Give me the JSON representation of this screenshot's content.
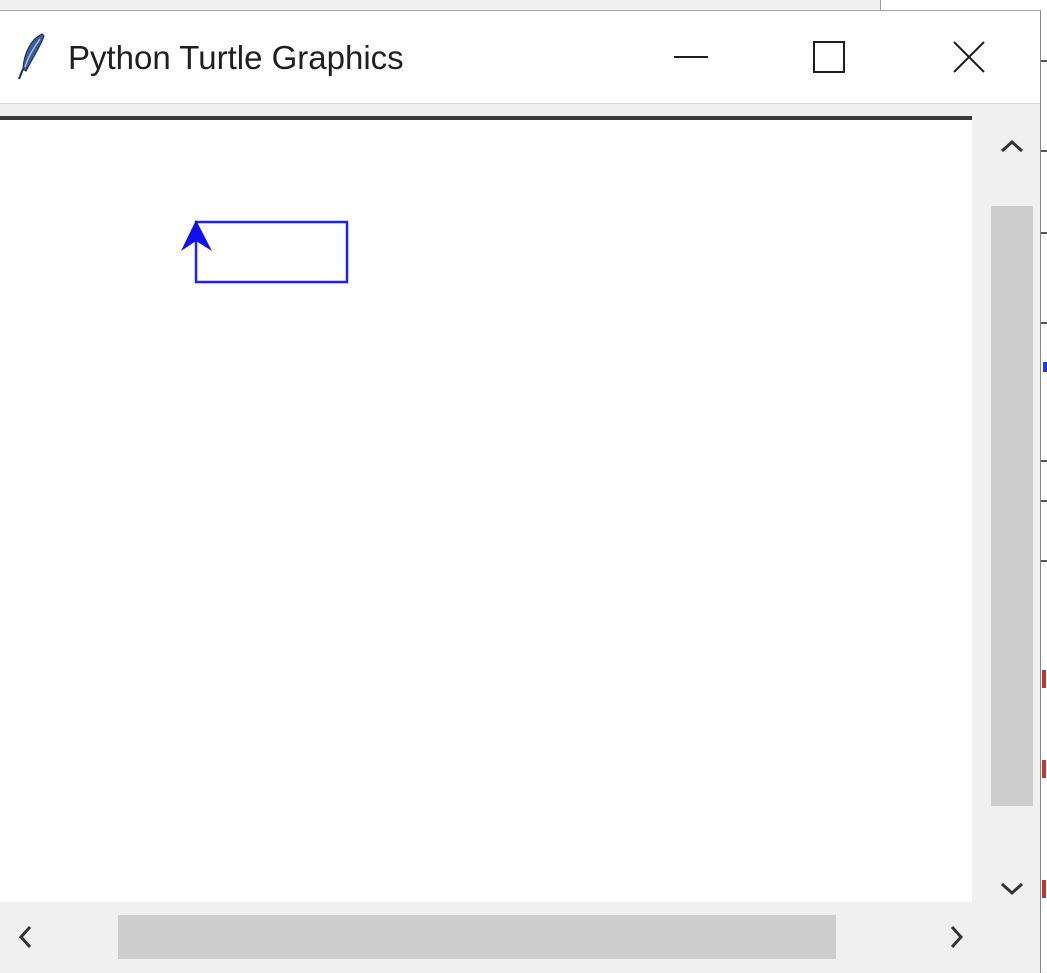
{
  "window": {
    "title": "Python Turtle Graphics",
    "icon": "feather-icon"
  },
  "controls": {
    "minimize": "minimize-icon",
    "maximize": "maximize-icon",
    "close": "close-icon"
  },
  "canvas": {
    "pen_color": "#1f1fff",
    "turtle_heading": "up"
  },
  "scrollbars": {
    "vertical": [
      "chevron-up-icon",
      "chevron-down-icon"
    ],
    "horizontal": [
      "chevron-left-icon",
      "chevron-right-icon"
    ]
  }
}
